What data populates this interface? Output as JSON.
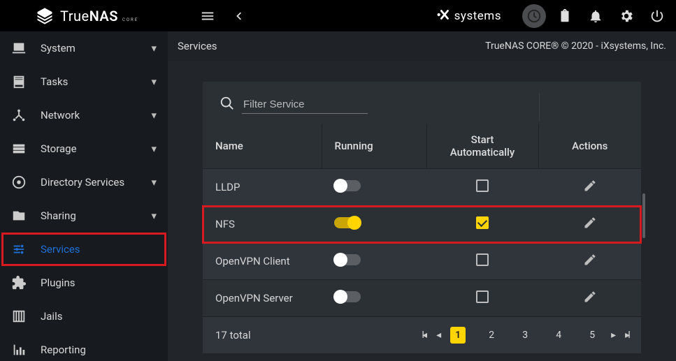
{
  "app": {
    "brand_a": "True",
    "brand_b": "NAS",
    "brand_sub": "CORE",
    "ix_brand": "systems"
  },
  "sidebar": {
    "items": [
      {
        "label": "System",
        "expandable": true
      },
      {
        "label": "Tasks",
        "expandable": true
      },
      {
        "label": "Network",
        "expandable": true
      },
      {
        "label": "Storage",
        "expandable": true
      },
      {
        "label": "Directory Services",
        "expandable": true
      },
      {
        "label": "Sharing",
        "expandable": true
      },
      {
        "label": "Services",
        "expandable": false,
        "active": true
      },
      {
        "label": "Plugins",
        "expandable": false
      },
      {
        "label": "Jails",
        "expandable": false
      },
      {
        "label": "Reporting",
        "expandable": false
      }
    ]
  },
  "crumb": {
    "title": "Services"
  },
  "footer": {
    "text": "TrueNAS CORE® © 2020 - iXsystems, Inc."
  },
  "search": {
    "placeholder": "Filter Service"
  },
  "table": {
    "headers": {
      "name": "Name",
      "running": "Running",
      "auto": "Start Automatically",
      "actions": "Actions"
    },
    "rows": [
      {
        "name": "LLDP",
        "running": false,
        "auto": false,
        "highlight": false
      },
      {
        "name": "NFS",
        "running": true,
        "auto": true,
        "highlight": true
      },
      {
        "name": "OpenVPN Client",
        "running": false,
        "auto": false,
        "highlight": false
      },
      {
        "name": "OpenVPN Server",
        "running": false,
        "auto": false,
        "highlight": false
      }
    ],
    "total_label": "17 total",
    "pages": [
      "1",
      "2",
      "3",
      "4",
      "5"
    ],
    "current_page": "1"
  }
}
